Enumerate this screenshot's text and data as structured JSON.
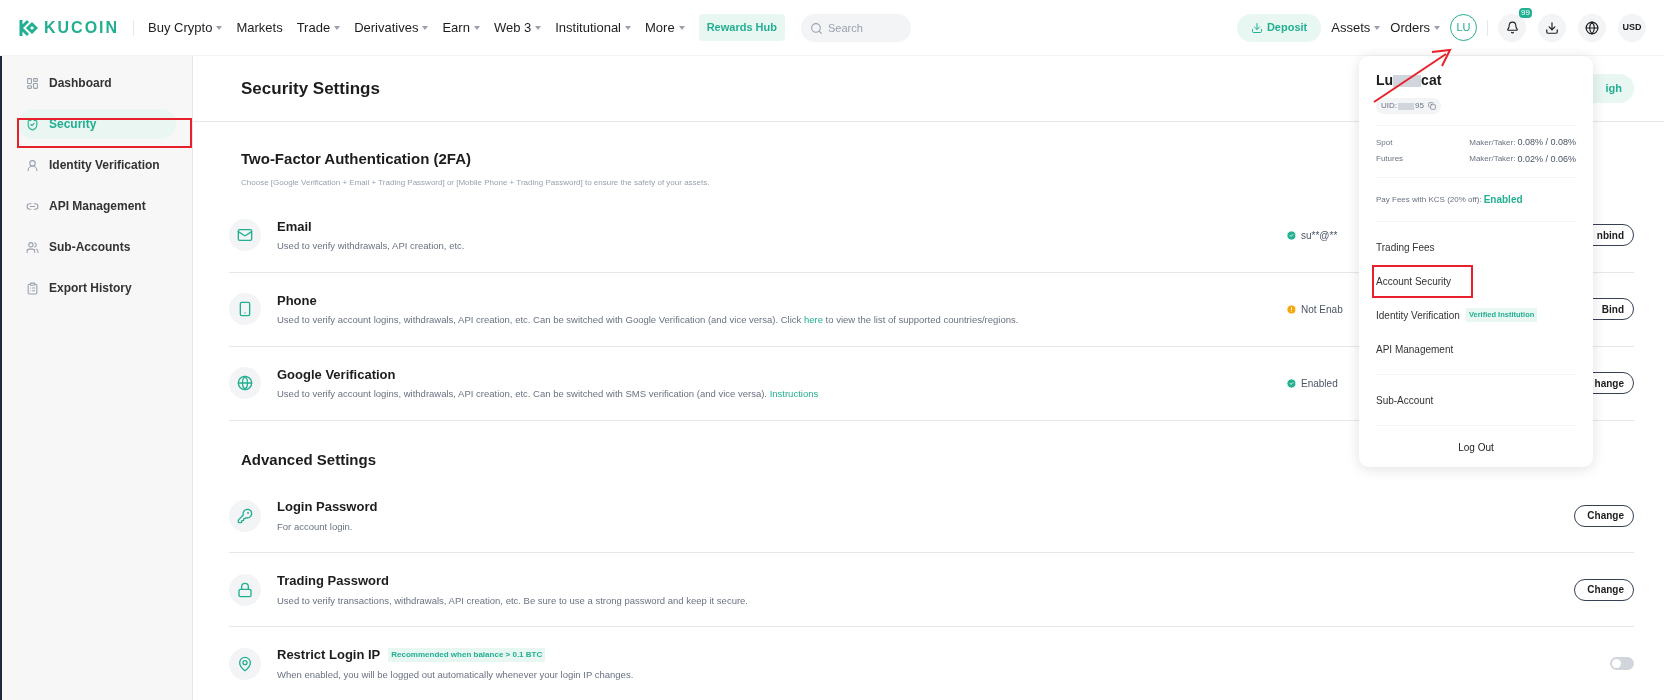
{
  "topbar": {
    "logo": "KUCOIN",
    "nav": [
      {
        "label": "Buy Crypto",
        "caret": true
      },
      {
        "label": "Markets",
        "caret": false
      },
      {
        "label": "Trade",
        "caret": true
      },
      {
        "label": "Derivatives",
        "caret": true
      },
      {
        "label": "Earn",
        "caret": true
      },
      {
        "label": "Web 3",
        "caret": true
      },
      {
        "label": "Institutional",
        "caret": true
      },
      {
        "label": "More",
        "caret": true
      }
    ],
    "rewards": "Rewards Hub",
    "search": {
      "placeholder": "Search"
    },
    "deposit": "Deposit",
    "right_nav": [
      {
        "label": "Assets",
        "caret": true
      },
      {
        "label": "Orders",
        "caret": true
      }
    ],
    "avatar": "LU",
    "notification_badge": "99",
    "currency": "USD"
  },
  "sidebar": {
    "items": [
      {
        "label": "Dashboard",
        "selected": false
      },
      {
        "label": "Security",
        "selected": true
      },
      {
        "label": "Identity Verification",
        "selected": false
      },
      {
        "label": "API Management",
        "selected": false
      },
      {
        "label": "Sub-Accounts",
        "selected": false
      },
      {
        "label": "Export History",
        "selected": false
      }
    ]
  },
  "page": {
    "title": "Security Settings",
    "level_badge": "igh",
    "sections": [
      {
        "title": "Two-Factor Authentication (2FA)",
        "subtitle": "Choose [Google Verification + Email + Trading Password] or [Mobile Phone + Trading Password] to ensure the safety of your assets.",
        "rows": [
          {
            "kind": "button",
            "title": "Email",
            "desc": "Used to verify withdrawals, API creation, etc.",
            "status": {
              "warning": false,
              "text": "su**@**"
            },
            "action": "nbind"
          },
          {
            "kind": "button",
            "title": "Phone",
            "desc": "Used to verify account logins, withdrawals, API creation, etc. Can be switched with Google Verification (and vice versa). Click ",
            "link": "here",
            "desc_after": " to view the list of supported countries/regions.",
            "status": {
              "warning": true,
              "text": "Not Enab"
            },
            "action": "Bind"
          },
          {
            "kind": "button",
            "title": "Google Verification",
            "desc": "Used to verify account logins, withdrawals, API creation, etc. Can be switched with SMS verification (and vice versa). ",
            "link": "Instructions",
            "status": {
              "warning": false,
              "text": "Enabled"
            },
            "action": "hange"
          }
        ]
      },
      {
        "title": "Advanced Settings",
        "rows": [
          {
            "kind": "button",
            "title": "Login Password",
            "desc": "For account login.",
            "action": "Change"
          },
          {
            "kind": "button",
            "title": "Trading Password",
            "desc": "Used to verify transactions, withdrawals, API creation, etc. Be sure to use a strong password and keep it secure.",
            "action": "Change"
          },
          {
            "kind": "toggle",
            "title": "Restrict Login IP",
            "tag": "Recommended when balance > 0.1 BTC",
            "desc": "When enabled, you will be logged out automatically whenever your login IP changes.",
            "on": false
          }
        ]
      }
    ]
  },
  "menu": {
    "name_start": "Lu",
    "name_end": "cat",
    "uid_start": "UID:",
    "uid_end": "95",
    "fees": [
      {
        "market": "Spot",
        "label": "Maker/Taker:",
        "value": "0.08% / 0.08%"
      },
      {
        "market": "Futures",
        "label": "Maker/Taker:",
        "value": "0.02% / 0.06%"
      }
    ],
    "kcs_label": "Pay Fees with KCS (20% off):",
    "kcs_value": "Enabled",
    "groups": [
      [
        {
          "label": "Trading Fees",
          "highlighted": false
        },
        {
          "label": "Account Security",
          "highlighted": true
        },
        {
          "label": "Identity Verification",
          "tag": "Verified Institution",
          "highlighted": false
        },
        {
          "label": "API Management",
          "highlighted": false
        }
      ],
      [
        {
          "label": "Sub-Account",
          "highlighted": false
        }
      ]
    ],
    "logout": "Log Out"
  }
}
